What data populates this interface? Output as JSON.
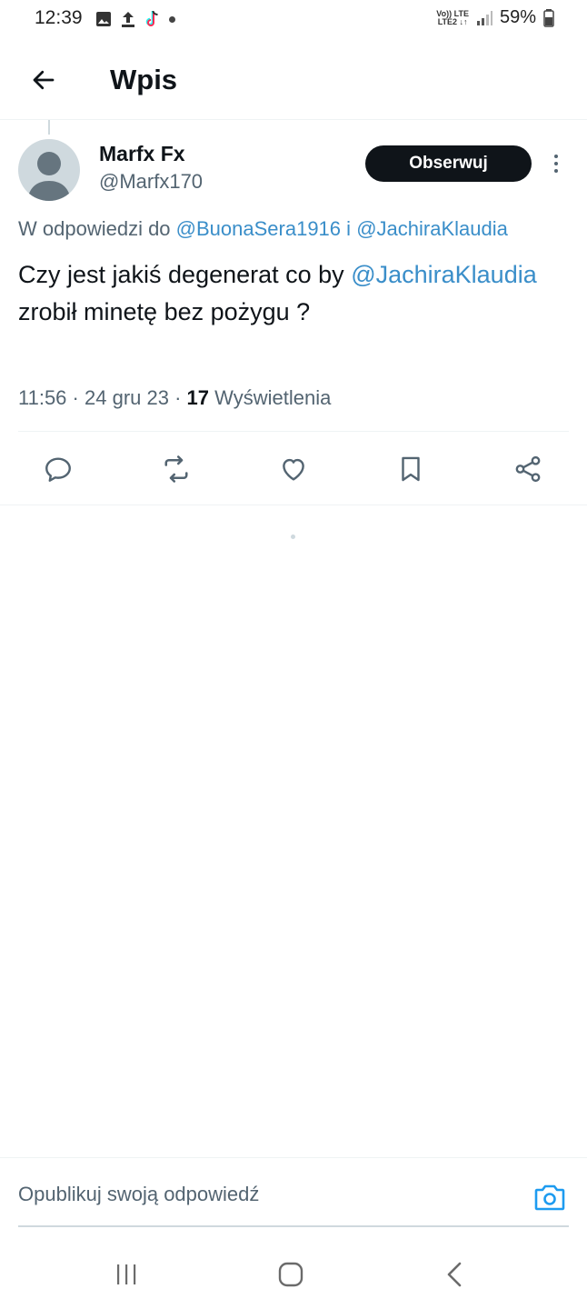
{
  "status_bar": {
    "time": "12:39",
    "left_icons": [
      "image-icon",
      "upload-icon",
      "tiktok-icon",
      "dot-icon"
    ],
    "network_top": "Vo)) LTE",
    "network_bottom": "LTE2 ↓↑",
    "battery": "59%"
  },
  "header": {
    "back_icon": "arrow-left-icon",
    "title": "Wpis"
  },
  "tweet": {
    "author_name": "Marfx Fx",
    "author_handle": "@Marfx170",
    "follow_label": "Obserwuj",
    "replying_prefix": "W odpowiedzi do",
    "replying_user_1": "@BuonaSera1916",
    "replying_join": "i",
    "replying_user_2": "@JachiraKlaudia",
    "text_part_1": "Czy jest jakiś degenerat co by",
    "text_mention": "@JachiraKlaudia",
    "text_part_2": "zrobił minetę bez pożygu ?",
    "time": "11:56",
    "date": "24 gru 23",
    "separator": "·",
    "views_count": "17",
    "views_label": "Wyświetlenia"
  },
  "actions": [
    "reply-icon",
    "retweet-icon",
    "like-icon",
    "bookmark-icon",
    "share-icon"
  ],
  "composer": {
    "placeholder": "Opublikuj swoją odpowiedź",
    "camera_icon": "camera-icon"
  },
  "navbar": [
    "recents-icon",
    "home-icon",
    "back-icon"
  ],
  "colors": {
    "accent": "#1d9bf0",
    "text": "#0f1419",
    "muted": "#536471",
    "divider": "#eff3f4"
  }
}
